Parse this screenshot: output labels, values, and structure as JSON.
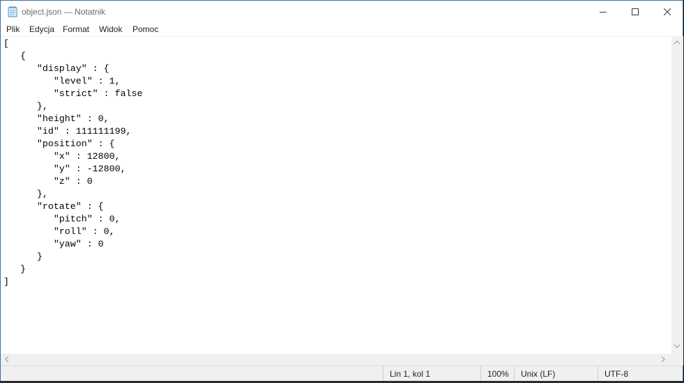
{
  "window": {
    "title": "object.json — Notatnik",
    "controls": {
      "minimize": "minimize",
      "maximize": "maximize",
      "close": "close"
    }
  },
  "menu": {
    "items": [
      {
        "label": "Plik"
      },
      {
        "label": "Edycja"
      },
      {
        "label": "Format"
      },
      {
        "label": "Widok"
      },
      {
        "label": "Pomoc"
      }
    ]
  },
  "editor": {
    "content": "[\n   {\n      \"display\" : {\n         \"level\" : 1,\n         \"strict\" : false\n      },\n      \"height\" : 0,\n      \"id\" : 111111199,\n      \"position\" : {\n         \"x\" : 12800,\n         \"y\" : -12800,\n         \"z\" : 0\n      },\n      \"rotate\" : {\n         \"pitch\" : 0,\n         \"roll\" : 0,\n         \"yaw\" : 0\n      }\n   }\n]"
  },
  "status": {
    "position": "Lin 1, kol 1",
    "zoom": "100%",
    "line_endings": "Unix (LF)",
    "encoding": "UTF-8"
  },
  "colors": {
    "window_border": "#3a6ea5",
    "background": "#ffffff",
    "chrome": "#f0f0f0"
  }
}
